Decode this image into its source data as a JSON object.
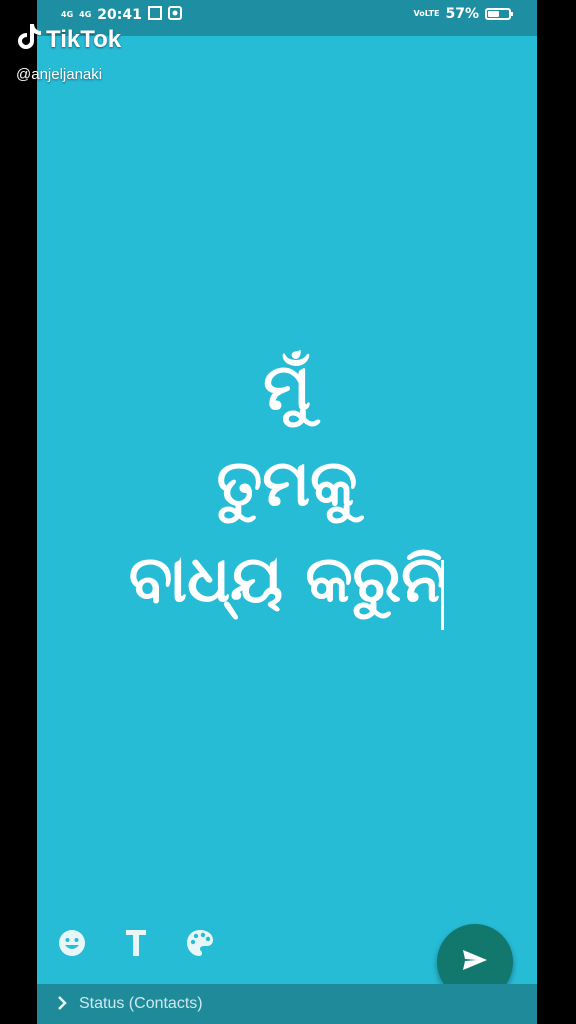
{
  "status_bar": {
    "signal_1": "4G",
    "signal_2": "4G",
    "time": "20:41",
    "network": "VoLTE",
    "battery": "57%",
    "battery_level": 0.57
  },
  "watermark": {
    "app": "TikTok",
    "handle": "@anjeljanaki"
  },
  "status_text": {
    "line1": "ମୁଁ",
    "line2": "ତୁମକୁ",
    "line3": "ବାଧ୍ୟ କରୁନି"
  },
  "tools": [
    "emoji-icon",
    "text-style-icon",
    "palette-icon"
  ],
  "send_icon": "send-icon",
  "footer": {
    "label": "Status (Contacts)"
  },
  "colors": {
    "background": "#27BCD6",
    "status_bar": "#1E8FA3",
    "send_button": "#12776C",
    "footer": "#1F8A99"
  }
}
